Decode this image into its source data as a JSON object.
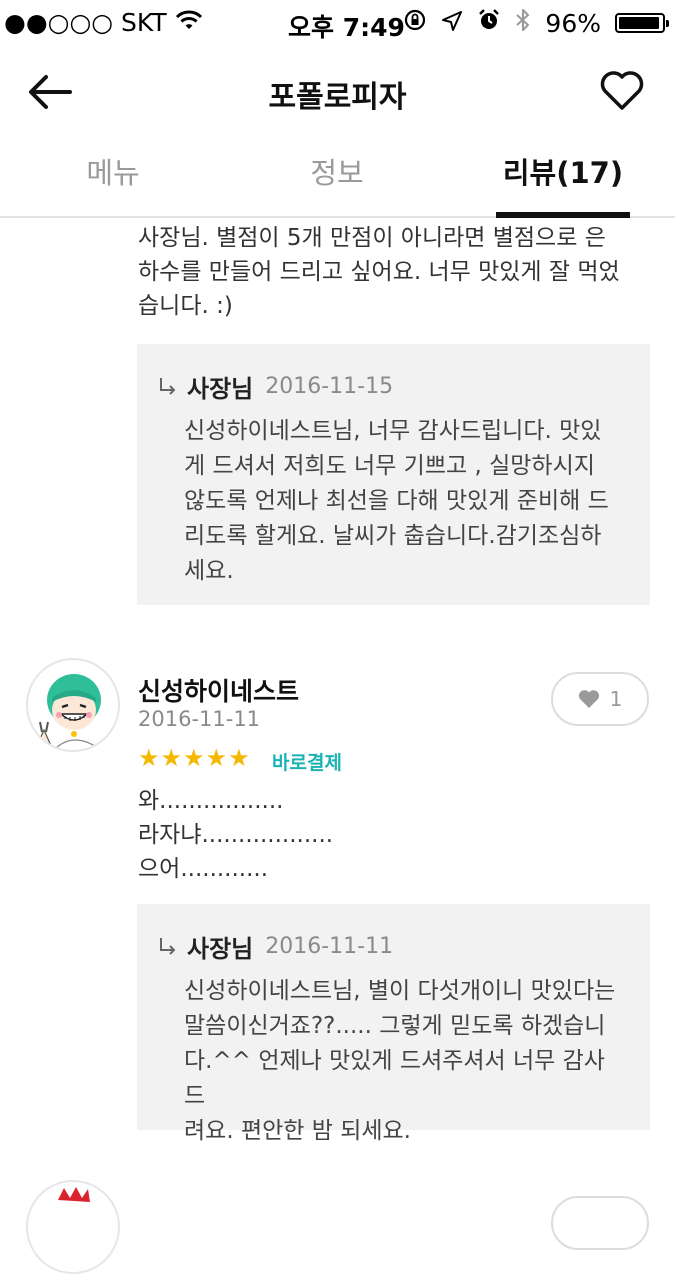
{
  "status": {
    "carrier": "●●○○○ SKT",
    "time": "오후 7:49",
    "battery": "96%",
    "battery_level": 0.96
  },
  "nav": {
    "title": "포폴로피자"
  },
  "tabs": [
    {
      "label": "메뉴"
    },
    {
      "label": "정보"
    },
    {
      "label": "리뷰(17)"
    }
  ],
  "review1": {
    "text_lines": [
      "사장님. 별점이 5개 만점이 아니라면 별점으로 은",
      "하수를 만들어 드리고 싶어요. 너무 맛있게 잘 먹었",
      "습니다. :)"
    ],
    "reply": {
      "owner": "사장님",
      "date": "2016-11-15",
      "lines": [
        "신성하이네스트님, 너무 감사드립니다. 맛있",
        "게 드셔서 저희도 너무 기쁘고 , 실망하시지",
        "않도록 언제나 최선을 다해 맛있게 준비해 드",
        "리도록 할게요. 날씨가 춥습니다.감기조심하",
        "세요."
      ]
    }
  },
  "review2": {
    "name": "신성하이네스트",
    "date": "2016-11-11",
    "stars": "★★★★★",
    "rating": 5,
    "badge": "바로결제",
    "likes": "1",
    "text_lines": [
      "와.................",
      "라자냐..................",
      "으어............"
    ],
    "reply": {
      "owner": "사장님",
      "date": "2016-11-11",
      "lines": [
        "신성하이네스트님, 별이 다섯개이니 맛있다는",
        "말씀이신거죠??..... 그렇게 믿도록 하겠습니",
        "다.^^  언제나 맛있게 드셔주셔서 너무 감사드",
        "려요. 편안한 밤 되세요."
      ]
    }
  },
  "colors": {
    "star": "#f5b800",
    "badge": "#1ab3b3",
    "reply_bg": "#f2f2f2"
  }
}
